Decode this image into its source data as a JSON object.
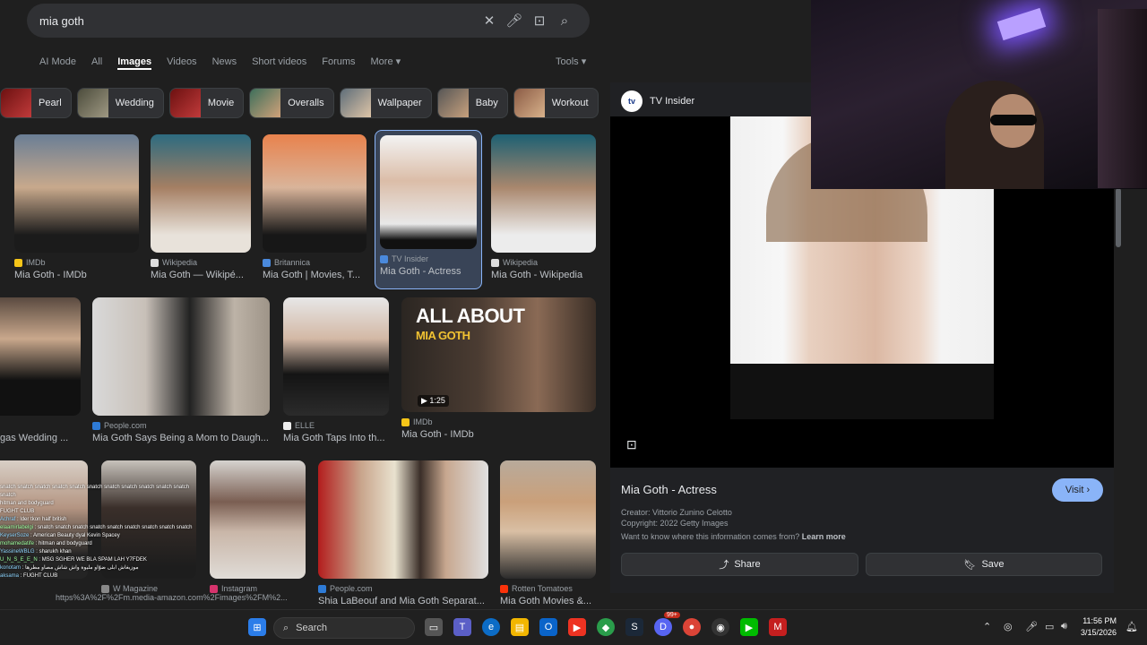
{
  "search": {
    "query": "mia goth"
  },
  "tabs": [
    "AI Mode",
    "All",
    "Images",
    "Videos",
    "News",
    "Short videos",
    "Forums",
    "More"
  ],
  "active_tab": "Images",
  "tools_label": "Tools",
  "chips": [
    "Pearl",
    "Wedding",
    "Movie",
    "Overalls",
    "Wallpaper",
    "Baby",
    "Workout"
  ],
  "results_row1": [
    {
      "source": "IMDb",
      "title": "Mia Goth - IMDb"
    },
    {
      "source": "Wikipedia",
      "title": "Mia Goth — Wikipé..."
    },
    {
      "source": "Britannica",
      "title": "Mia Goth | Movies, T..."
    },
    {
      "source": "TV Insider",
      "title": "Mia Goth - Actress"
    },
    {
      "source": "Wikipedia",
      "title": "Mia Goth - Wikipedia"
    }
  ],
  "results_row2": [
    {
      "source": "",
      "title": "gas Wedding ..."
    },
    {
      "source": "People.com",
      "title": "Mia Goth Says Being a Mom to Daugh..."
    },
    {
      "source": "ELLE",
      "title": "Mia Goth Taps Into th..."
    },
    {
      "source": "IMDb",
      "title": "Mia Goth - IMDb",
      "overlay1": "ALL ABOUT",
      "overlay2": "MIA GOTH",
      "duration": "1:25"
    }
  ],
  "results_row3": [
    {
      "source": "W Magazine",
      "title": ""
    },
    {
      "source": "Instagram",
      "title": ""
    },
    {
      "source": "People.com",
      "title": "Shia LaBeouf and Mia Goth Separat..."
    },
    {
      "source": "Rotten Tomatoes",
      "title": "Mia Goth Movies &..."
    }
  ],
  "panel": {
    "source": "TV Insider",
    "title": "Mia Goth - Actress",
    "visit_label": "Visit",
    "creator": "Creator: Vittorio Zunino Celotto",
    "copyright": "Copyright: 2022 Getty Images",
    "info_question": "Want to know where this information comes from?",
    "learn_more": "Learn more",
    "share_label": "Share",
    "save_label": "Save"
  },
  "status_url": "https%3A%2F%2Fm.media-amazon.com%2Fimages%2FM%2...",
  "chat": [
    {
      "user": "",
      "msg": "snatch snatch snatch snatch snatch snatch snatch snatch snatch snatch snatch snatch"
    },
    {
      "user": "",
      "msg": "hitman and bodyguard"
    },
    {
      "user": "",
      "msg": "FUGHT CLUB"
    },
    {
      "user": "Achraf",
      "msg": "lder tkon half british"
    },
    {
      "user": "elaamirlabelgi",
      "msg": "snatch snatch snatch snatch snatch snatch snatch snatch snatch"
    },
    {
      "user": "KeyserSoze",
      "msg": "American Beauty dyal Kevin Spacey"
    },
    {
      "user": "mohamedatife",
      "msg": "hitman and bodyguard"
    },
    {
      "user": "YassineWBLG",
      "msg": "sharukh khan"
    },
    {
      "user": "U_N_S_E_E_N",
      "msg": "MSG SGHER WE BLA SPAM LAH Y7FDEK"
    },
    {
      "user": "konotam",
      "msg": "موزيغاش ابلى ضوّاو مليوة واش شاش مصاو مطرها"
    },
    {
      "user": "aksama",
      "msg": "FUGHT CLUB"
    }
  ],
  "taskbar": {
    "search_label": "Search",
    "time": "11:56 PM",
    "date": "3/15/2026",
    "badge": "99+"
  }
}
